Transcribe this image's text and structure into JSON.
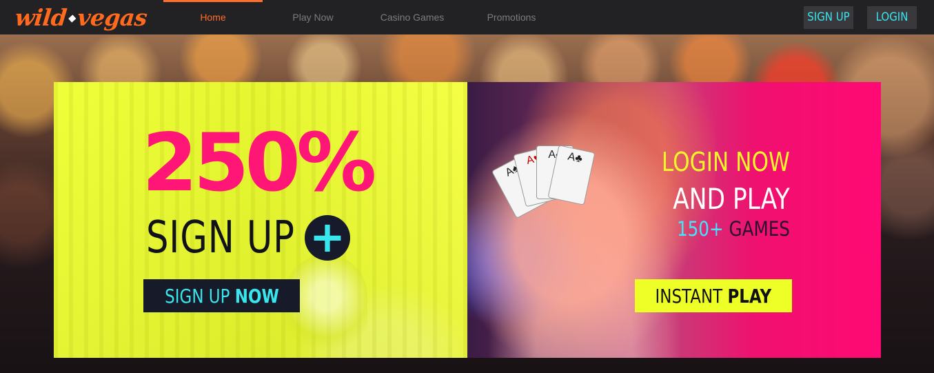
{
  "brand": {
    "logo_left": "wild",
    "logo_right": "vegas",
    "accent": "#ff6a1f"
  },
  "nav": {
    "items": [
      {
        "label": "Home",
        "active": true
      },
      {
        "label": "Play Now",
        "active": false
      },
      {
        "label": "Casino Games",
        "active": false
      },
      {
        "label": "Promotions",
        "active": false
      }
    ]
  },
  "auth": {
    "signup_label": "SIGN UP",
    "login_label": "LOGIN",
    "button_text_color": "#38e6ee"
  },
  "promo_left": {
    "percent": "250%",
    "signup_text": "SIGN UP",
    "plus_symbol": "+",
    "cta_prefix": "SIGN UP ",
    "cta_bold": "NOW",
    "background": "#efff3a",
    "percent_color": "#ff1677"
  },
  "promo_right": {
    "headline_1": "LOGIN NOW",
    "headline_2": "AND PLAY",
    "games_count": "150+",
    "games_label": " GAMES",
    "cta_prefix": "INSTANT ",
    "cta_bold": "PLAY",
    "cards": [
      "A♠",
      "A♥",
      "A♠",
      "A♣"
    ],
    "background": "#ff0a74"
  }
}
